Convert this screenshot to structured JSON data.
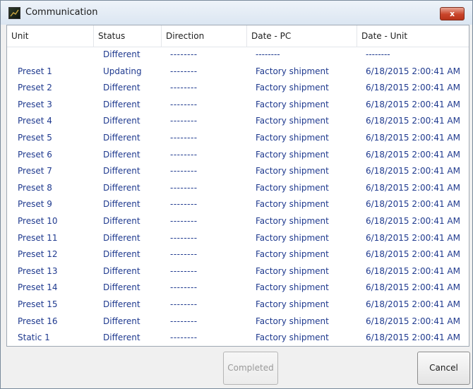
{
  "window": {
    "title": "Communication",
    "close_glyph": "x"
  },
  "table": {
    "headers": [
      "Unit",
      "Status",
      "Direction",
      "Date - PC",
      "Date - Unit"
    ],
    "rows": [
      {
        "unit": "",
        "status": "Different",
        "direction": "--------",
        "date_pc": "--------",
        "date_unit": "--------"
      },
      {
        "unit": "Preset 1",
        "status": "Updating",
        "direction": "--------",
        "date_pc": "Factory shipment",
        "date_unit": "6/18/2015 2:00:41 AM"
      },
      {
        "unit": "Preset 2",
        "status": "Different",
        "direction": "--------",
        "date_pc": "Factory shipment",
        "date_unit": "6/18/2015 2:00:41 AM"
      },
      {
        "unit": "Preset 3",
        "status": "Different",
        "direction": "--------",
        "date_pc": "Factory shipment",
        "date_unit": "6/18/2015 2:00:41 AM"
      },
      {
        "unit": "Preset 4",
        "status": "Different",
        "direction": "--------",
        "date_pc": "Factory shipment",
        "date_unit": "6/18/2015 2:00:41 AM"
      },
      {
        "unit": "Preset 5",
        "status": "Different",
        "direction": "--------",
        "date_pc": "Factory shipment",
        "date_unit": "6/18/2015 2:00:41 AM"
      },
      {
        "unit": "Preset 6",
        "status": "Different",
        "direction": "--------",
        "date_pc": "Factory shipment",
        "date_unit": "6/18/2015 2:00:41 AM"
      },
      {
        "unit": "Preset 7",
        "status": "Different",
        "direction": "--------",
        "date_pc": "Factory shipment",
        "date_unit": "6/18/2015 2:00:41 AM"
      },
      {
        "unit": "Preset 8",
        "status": "Different",
        "direction": "--------",
        "date_pc": "Factory shipment",
        "date_unit": "6/18/2015 2:00:41 AM"
      },
      {
        "unit": "Preset 9",
        "status": "Different",
        "direction": "--------",
        "date_pc": "Factory shipment",
        "date_unit": "6/18/2015 2:00:41 AM"
      },
      {
        "unit": "Preset 10",
        "status": "Different",
        "direction": "--------",
        "date_pc": "Factory shipment",
        "date_unit": "6/18/2015 2:00:41 AM"
      },
      {
        "unit": "Preset 11",
        "status": "Different",
        "direction": "--------",
        "date_pc": "Factory shipment",
        "date_unit": "6/18/2015 2:00:41 AM"
      },
      {
        "unit": "Preset 12",
        "status": "Different",
        "direction": "--------",
        "date_pc": "Factory shipment",
        "date_unit": "6/18/2015 2:00:41 AM"
      },
      {
        "unit": "Preset 13",
        "status": "Different",
        "direction": "--------",
        "date_pc": "Factory shipment",
        "date_unit": "6/18/2015 2:00:41 AM"
      },
      {
        "unit": "Preset 14",
        "status": "Different",
        "direction": "--------",
        "date_pc": "Factory shipment",
        "date_unit": "6/18/2015 2:00:41 AM"
      },
      {
        "unit": "Preset 15",
        "status": "Different",
        "direction": "--------",
        "date_pc": "Factory shipment",
        "date_unit": "6/18/2015 2:00:41 AM"
      },
      {
        "unit": "Preset 16",
        "status": "Different",
        "direction": "--------",
        "date_pc": "Factory shipment",
        "date_unit": "6/18/2015 2:00:41 AM"
      },
      {
        "unit": "Static 1",
        "status": "Different",
        "direction": "--------",
        "date_pc": "Factory shipment",
        "date_unit": "6/18/2015 2:00:41 AM"
      }
    ]
  },
  "buttons": {
    "completed_label": "Completed",
    "cancel_label": "Cancel"
  },
  "colors": {
    "row_text": "#1f3a8f",
    "close_button": "#c9442a"
  },
  "icons": {
    "app": "app-icon",
    "close": "close-icon"
  }
}
